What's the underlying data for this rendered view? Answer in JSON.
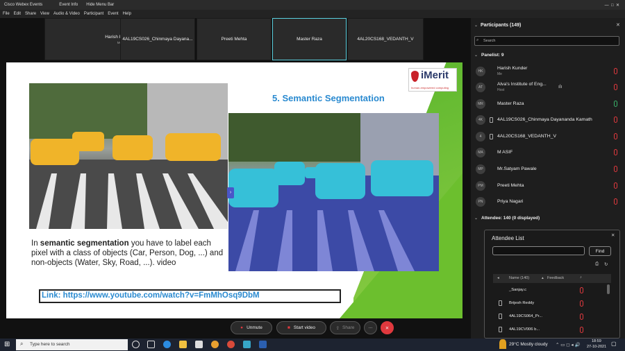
{
  "window": {
    "app_title": "Cisco Webex Events",
    "event_info": "Event Info",
    "hide_menu_bar": "Hide Menu Bar"
  },
  "menu": [
    "File",
    "Edit",
    "Share",
    "View",
    "Audio & Video",
    "Participant",
    "Event",
    "Help"
  ],
  "video_thumbnails": [
    {
      "name": "Harish Kunder",
      "sub": "Me"
    },
    {
      "name": "4AL19CS026_Chinmaya Dayana...",
      "sub": ""
    },
    {
      "name": "Preeti Mehta",
      "sub": ""
    },
    {
      "name": "Master Raza",
      "sub": ""
    },
    {
      "name": "4AL20CS168_VEDANTH_V",
      "sub": ""
    }
  ],
  "slide": {
    "title": "5. Semantic Segmentation",
    "logo_text": "iMerit",
    "logo_tagline": "human-empowered computing",
    "body_prefix": "In ",
    "body_bold": "semantic segmentation",
    "body_rest": " you have to label each pixel with a class of objects (Car, Person, Dog, ...) and non-objects (Water, Sky, Road, ...). video",
    "link": "Link: https://www.youtube.com/watch?v=FmMhOsq9DbM"
  },
  "controls": {
    "unmute": "Unmute",
    "start_video": "Start video",
    "share": "Share",
    "more": "···"
  },
  "panel": {
    "title": "Participants (149)",
    "search_placeholder": "Search",
    "panelist_header": "Panelist: 9",
    "attendee_header": "Attendee: 140 (0 displayed)",
    "panelists": [
      {
        "initials": "HK",
        "name": "Harish Kunder",
        "sub": "Me",
        "mic": "muted"
      },
      {
        "initials": "AT",
        "name": "Alva's Institute of Eng...",
        "sub": "Host",
        "mic": "muted"
      },
      {
        "initials": "MR",
        "name": "Master Raza",
        "sub": "",
        "mic": "active"
      },
      {
        "initials": "4K",
        "name": "4AL19CS026_Chinmaya Dayananda Kamath",
        "sub": "",
        "mic": "muted"
      },
      {
        "initials": "4",
        "name": "4AL20CS168_VEDANTH_V",
        "sub": "",
        "mic": "muted"
      },
      {
        "initials": "MA",
        "name": "M ASIF",
        "sub": "",
        "mic": "muted"
      },
      {
        "initials": "MP",
        "name": "Mr.Satyam Pawale",
        "sub": "",
        "mic": "muted"
      },
      {
        "initials": "PM",
        "name": "Preeti Mehta",
        "sub": "",
        "mic": "muted"
      },
      {
        "initials": "PN",
        "name": "Priya Nagari",
        "sub": "",
        "mic": "muted"
      }
    ]
  },
  "attendee_list": {
    "title": "Attendee List",
    "find": "Find",
    "col_name": "Name (140)",
    "col_feedback": "Feedback",
    "rows": [
      "_Sanjay.c",
      "Brijesh Reddy",
      "4AL19CS064_Pr...",
      "4AL19CV006 b..."
    ]
  },
  "taskbar": {
    "search_placeholder": "Type here to search",
    "weather": "29°C  Mostly cloudy",
    "time": "18:59",
    "date": "27-10-2021"
  }
}
